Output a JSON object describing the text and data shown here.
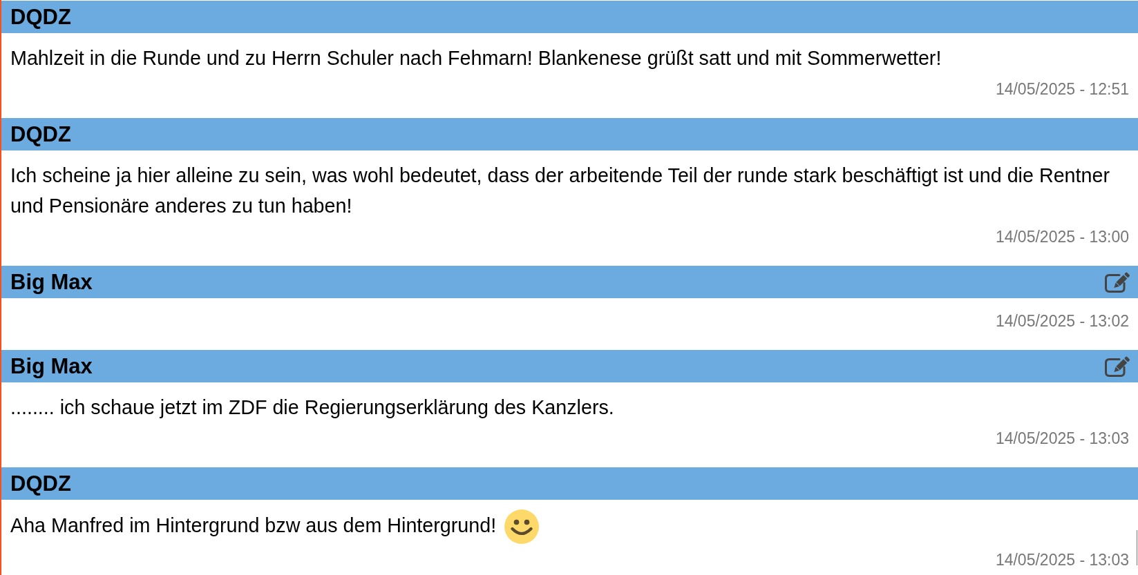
{
  "messages": [
    {
      "author": "DQDZ",
      "editable": false,
      "text": "Mahlzeit in die Runde und zu Herrn Schuler nach Fehmarn! Blankenese grüßt satt und mit Sommerwetter!",
      "emoji": false,
      "timestamp": "14/05/2025 - 12:51"
    },
    {
      "author": "DQDZ",
      "editable": false,
      "text": "Ich scheine ja hier alleine zu sein, was wohl bedeutet, dass der arbeitende Teil der runde stark beschäftigt ist und die Rentner und Pensionäre anderes zu tun haben!",
      "emoji": false,
      "timestamp": "14/05/2025 - 13:00"
    },
    {
      "author": "Big Max",
      "editable": true,
      "emoji": false,
      "timestamp": "14/05/2025 - 13:02"
    },
    {
      "author": "Big Max",
      "editable": true,
      "text": "........ ich schaue jetzt im ZDF die Regierungserklärung des Kanzlers.",
      "emoji": false,
      "timestamp": "14/05/2025 - 13:03"
    },
    {
      "author": "DQDZ",
      "editable": false,
      "text": "Aha Manfred im Hintergrund bzw aus dem Hintergrund!",
      "emoji": true,
      "timestamp": "14/05/2025 - 13:03"
    }
  ]
}
